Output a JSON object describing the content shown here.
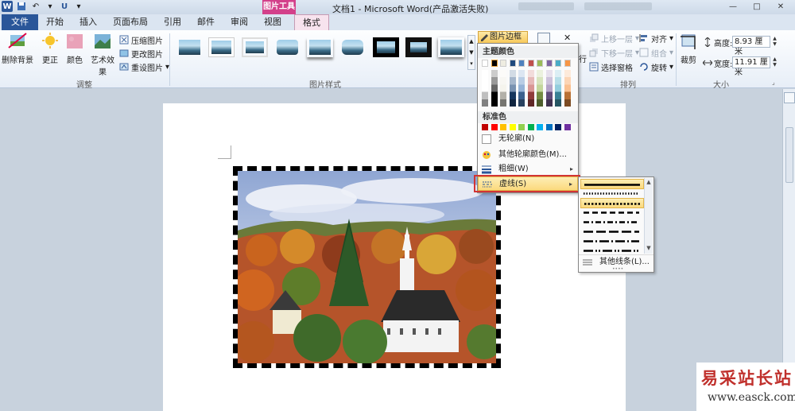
{
  "titlebar": {
    "title": "文档1 - Microsoft Word(产品激活失败)",
    "context_tab_title": "图片工具",
    "minimize": "—",
    "maximize": "□",
    "close": "✕"
  },
  "tabs": {
    "file": "文件",
    "home": "开始",
    "insert": "插入",
    "layout": "页面布局",
    "references": "引用",
    "mailings": "邮件",
    "review": "审阅",
    "view": "视图",
    "format": "格式"
  },
  "ribbon": {
    "adjust": {
      "remove_bg": "删除背景",
      "corrections": "更正",
      "color": "颜色",
      "artistic": "艺术效果",
      "compress": "压缩图片",
      "change": "更改图片",
      "reset": "重设图片",
      "label": "调整"
    },
    "styles": {
      "label": "图片样式",
      "border_button": "图片边框"
    },
    "arrange": {
      "label": "排列",
      "bring_forward": "上移一层",
      "send_backward": "下移一层",
      "selection_pane": "选择窗格",
      "align": "对齐",
      "group": "组合",
      "rotate": "旋转",
      "wrap_partial": "行"
    },
    "size": {
      "label": "大小",
      "crop": "裁剪",
      "height_label": "高度:",
      "height_value": "8.93 厘米",
      "width_label": "宽度:",
      "width_value": "11.91 厘米"
    }
  },
  "menu": {
    "theme_colors": "主题颜色",
    "standard_colors": "标准色",
    "no_outline": "无轮廓(N)",
    "more_colors": "其他轮廓颜色(M)...",
    "weight": "粗细(W)",
    "dashes": "虚线(S)"
  },
  "submenu": {
    "more_lines": "其他线条(L)..."
  },
  "colors": {
    "theme_top": [
      "#ffffff",
      "#000000",
      "#eeece1",
      "#1f497d",
      "#4f81bd",
      "#c0504d",
      "#9bbb59",
      "#8064a2",
      "#4bacc6",
      "#f79646"
    ],
    "standard": [
      "#c00000",
      "#ff0000",
      "#ffc000",
      "#ffff00",
      "#92d050",
      "#00b050",
      "#00b0f0",
      "#0070c0",
      "#002060",
      "#7030a0"
    ],
    "ribbon_file_tab": "#2a5699",
    "context_tab": "#d3408a",
    "highlight_border": "#d23434"
  },
  "watermark": {
    "name": "易采站长站",
    "url": "www.easck.com"
  }
}
